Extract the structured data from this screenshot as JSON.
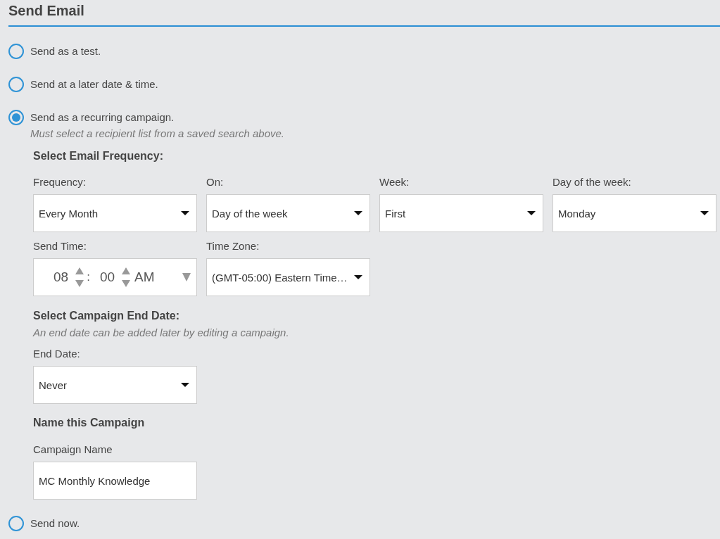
{
  "title": "Send Email",
  "options": [
    {
      "label": "Send as a test.",
      "selected": false
    },
    {
      "label": "Send at a later date & time.",
      "selected": false
    },
    {
      "label": "Send as a recurring campaign.",
      "note": "Must select a recipient list from a saved search above.",
      "selected": true,
      "details": {
        "frequency_heading": "Select Email Frequency:",
        "frequency_fields": [
          {
            "label": "Frequency:",
            "value": "Every Month"
          },
          {
            "label": "On:",
            "value": "Day of the week"
          },
          {
            "label": "Week:",
            "value": "First"
          },
          {
            "label": "Day of the week:",
            "value": "Monday"
          }
        ],
        "send_time": {
          "label": "Send Time:",
          "hour": "08",
          "separator": ":",
          "minute": "00",
          "period": "AM"
        },
        "time_zone": {
          "label": "Time Zone:",
          "value": "(GMT-05:00) Eastern Time…"
        },
        "end_heading": "Select Campaign End Date:",
        "end_note": "An end date can be added later by editing a campaign.",
        "end_date": {
          "label": "End Date:",
          "value": "Never"
        },
        "name_heading": "Name this Campaign",
        "campaign_name": {
          "label": "Campaign Name",
          "value": "MC Monthly Knowledge"
        }
      }
    },
    {
      "label": "Send now.",
      "selected": false
    }
  ]
}
